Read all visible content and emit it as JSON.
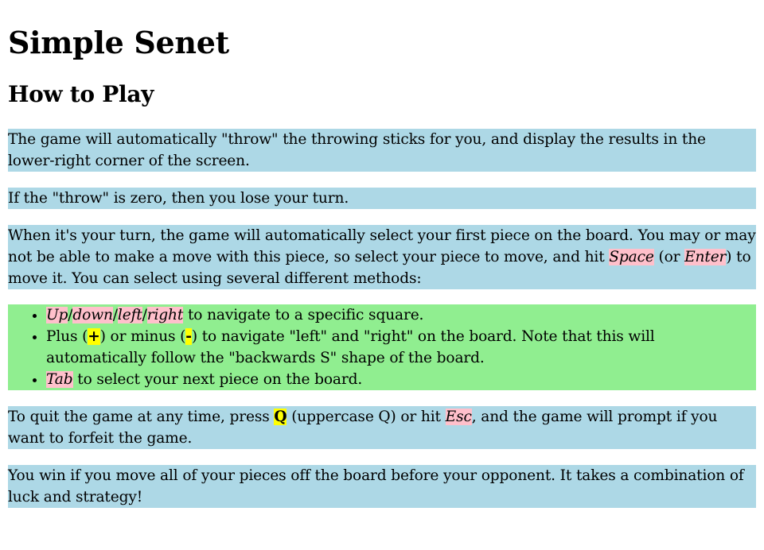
{
  "page": {
    "title": "Simple Senet",
    "subtitle": "How to Play"
  },
  "colors": {
    "paragraph_bg": "#add8e6",
    "list_bg": "#90ee90",
    "key_highlight": "#ffc0cb",
    "kbd_highlight": "#ffff00"
  },
  "paragraphs": {
    "p1": "The game will automatically \"throw\" the throwing sticks for you, and display the results in the lower-right corner of the screen.",
    "p2": "If the \"throw\" is zero, then you lose your turn.",
    "p3": {
      "a": "When it's your turn, the game will automatically select your first piece on the board. You may or may not be able to make a move with this piece, so select your piece to move, and hit ",
      "space_key": "Space",
      "b": " (or ",
      "enter_key": "Enter",
      "c": ") to move it. You can select using several different methods:"
    },
    "list": {
      "item1": {
        "up": "Up",
        "sep1": "/",
        "down": "down",
        "sep2": "/",
        "left": "left",
        "sep3": "/",
        "right": "right",
        "rest": " to navigate to a specific square."
      },
      "item2": {
        "a": "Plus (",
        "plus": "+",
        "b": ") or minus (",
        "minus": "-",
        "c": ") to navigate \"left\" and \"right\" on the board. Note that this will automatically follow the \"backwards S\" shape of the board."
      },
      "item3": {
        "tab": "Tab",
        "rest": " to select your next piece on the board."
      }
    },
    "p4": {
      "a": "To quit the game at any time, press ",
      "q_key": "Q",
      "b": " (uppercase Q) or hit ",
      "esc_key": "Esc",
      "c": ", and the game will prompt if you want to forfeit the game."
    },
    "p5": "You win if you move all of your pieces off the board before your opponent. It takes a combination of luck and strategy!"
  }
}
